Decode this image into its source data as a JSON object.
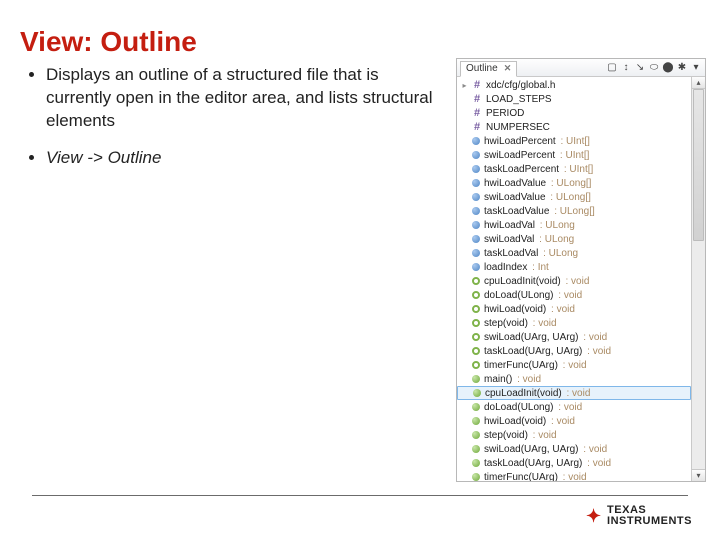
{
  "title": "View: Outline",
  "bullets": [
    {
      "text": "Displays an outline of a structured file that is currently open in the editor area, and lists structural elements",
      "italic": false
    },
    {
      "text": "View -> Outline",
      "italic": true
    }
  ],
  "panel": {
    "tab_label": "Outline",
    "toolbar_icons": [
      "▢",
      "↕",
      "↘",
      "⬭",
      "⬤",
      "✱",
      "▾"
    ],
    "items": [
      {
        "icon": "hash",
        "name": "xdc/cfg/global.h",
        "type": "",
        "tri": true
      },
      {
        "icon": "hash",
        "name": "LOAD_STEPS",
        "type": "",
        "tri": false
      },
      {
        "icon": "hash",
        "name": "PERIOD",
        "type": "",
        "tri": false
      },
      {
        "icon": "hash",
        "name": "NUMPERSEC",
        "type": "",
        "tri": false
      },
      {
        "icon": "dot-blue",
        "name": "hwiLoadPercent",
        "type": ": UInt[]",
        "tri": false
      },
      {
        "icon": "dot-blue",
        "name": "swiLoadPercent",
        "type": ": UInt[]",
        "tri": false
      },
      {
        "icon": "dot-blue",
        "name": "taskLoadPercent",
        "type": ": UInt[]",
        "tri": false
      },
      {
        "icon": "dot-blue",
        "name": "hwiLoadValue",
        "type": ": ULong[]",
        "tri": false
      },
      {
        "icon": "dot-blue",
        "name": "swiLoadValue",
        "type": ": ULong[]",
        "tri": false
      },
      {
        "icon": "dot-blue",
        "name": "taskLoadValue",
        "type": ": ULong[]",
        "tri": false
      },
      {
        "icon": "dot-blue",
        "name": "hwiLoadVal",
        "type": ": ULong",
        "tri": false
      },
      {
        "icon": "dot-blue",
        "name": "swiLoadVal",
        "type": ": ULong",
        "tri": false
      },
      {
        "icon": "dot-blue",
        "name": "taskLoadVal",
        "type": ": ULong",
        "tri": false
      },
      {
        "icon": "dot-blue",
        "name": "loadIndex",
        "type": ": Int",
        "tri": false
      },
      {
        "icon": "ring-green",
        "name": "cpuLoadInit(void)",
        "type": ": void",
        "tri": false
      },
      {
        "icon": "ring-green",
        "name": "doLoad(ULong)",
        "type": ": void",
        "tri": false
      },
      {
        "icon": "ring-green",
        "name": "hwiLoad(void)",
        "type": ": void",
        "tri": false
      },
      {
        "icon": "ring-green",
        "name": "step(void)",
        "type": ": void",
        "tri": false
      },
      {
        "icon": "ring-green",
        "name": "swiLoad(UArg, UArg)",
        "type": ": void",
        "tri": false
      },
      {
        "icon": "ring-green",
        "name": "taskLoad(UArg, UArg)",
        "type": ": void",
        "tri": false
      },
      {
        "icon": "ring-green",
        "name": "timerFunc(UArg)",
        "type": ": void",
        "tri": false
      },
      {
        "icon": "dot-green",
        "name": "main()",
        "type": ": void",
        "tri": false
      },
      {
        "icon": "dot-green",
        "name": "cpuLoadInit(void)",
        "type": ": void",
        "tri": false,
        "selected": true
      },
      {
        "icon": "dot-green",
        "name": "doLoad(ULong)",
        "type": ": void",
        "tri": false
      },
      {
        "icon": "dot-green",
        "name": "hwiLoad(void)",
        "type": ": void",
        "tri": false
      },
      {
        "icon": "dot-green",
        "name": "step(void)",
        "type": ": void",
        "tri": false
      },
      {
        "icon": "dot-green",
        "name": "swiLoad(UArg, UArg)",
        "type": ": void",
        "tri": false
      },
      {
        "icon": "dot-green",
        "name": "taskLoad(UArg, UArg)",
        "type": ": void",
        "tri": false
      },
      {
        "icon": "dot-green",
        "name": "timerFunc(UArg)",
        "type": ": void",
        "tri": false
      }
    ]
  },
  "logo": {
    "line1": "TEXAS",
    "line2": "INSTRUMENTS"
  }
}
